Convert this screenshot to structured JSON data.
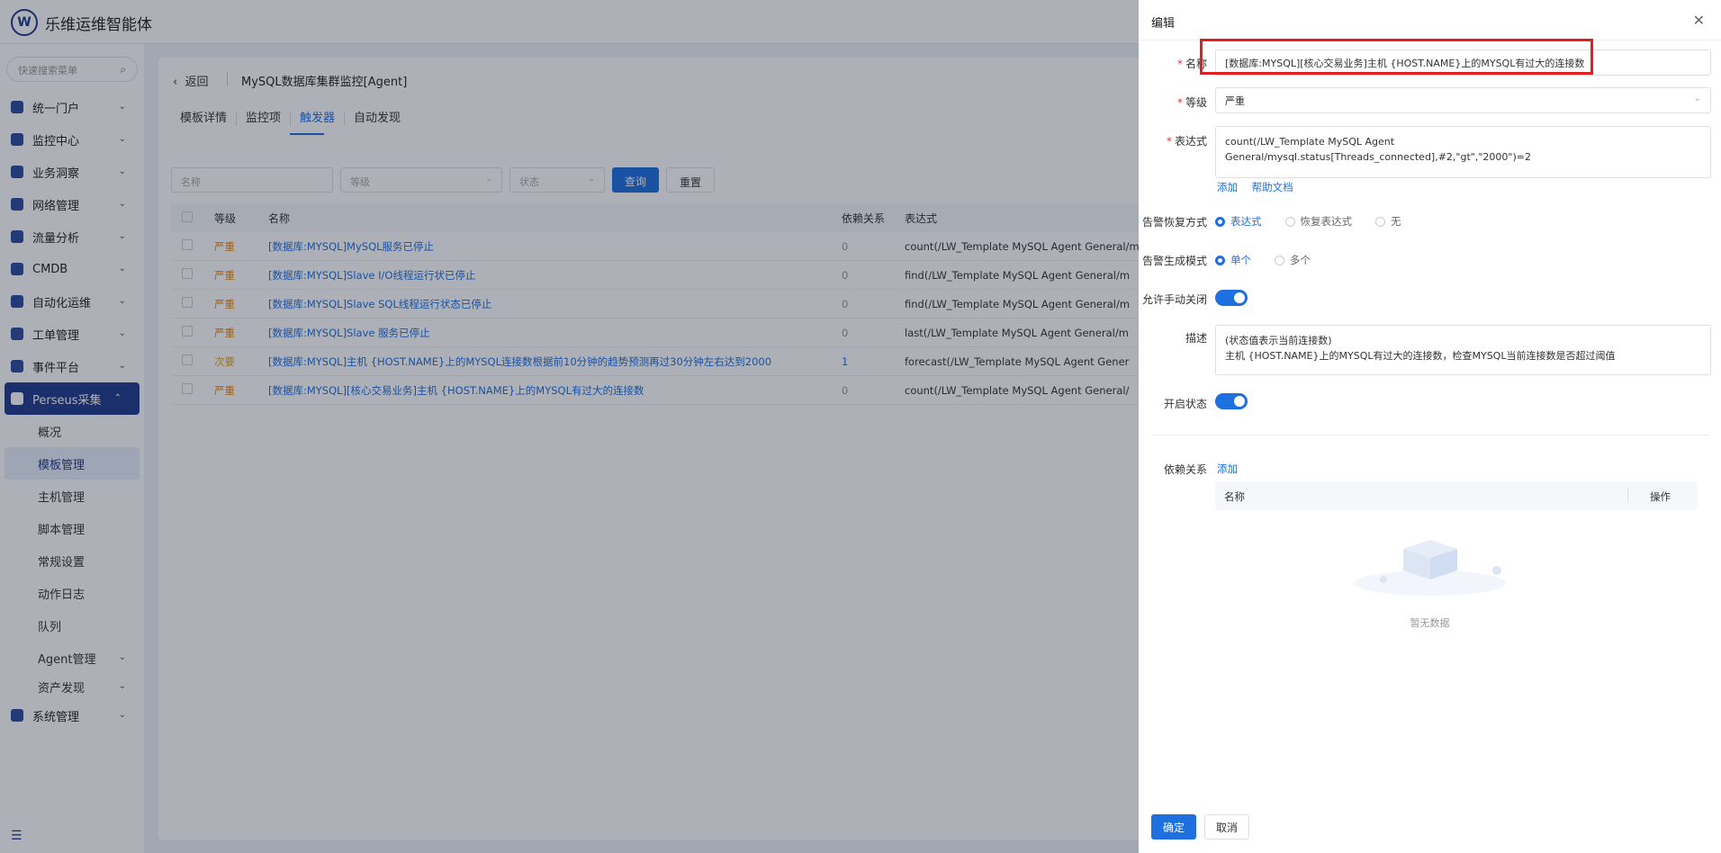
{
  "brand": {
    "logo": "W",
    "name": "乐维运维智能体"
  },
  "sidebar": {
    "search_placeholder": "快速搜索菜单",
    "items": [
      {
        "label": "统一门户",
        "icon": "home-icon"
      },
      {
        "label": "监控中心",
        "icon": "monitor-icon"
      },
      {
        "label": "业务洞察",
        "icon": "insight-icon"
      },
      {
        "label": "网络管理",
        "icon": "globe-icon"
      },
      {
        "label": "流量分析",
        "icon": "chart-icon"
      },
      {
        "label": "CMDB",
        "icon": "cube-icon"
      },
      {
        "label": "自动化运维",
        "icon": "gear-icon"
      },
      {
        "label": "工单管理",
        "icon": "ticket-icon"
      },
      {
        "label": "事件平台",
        "icon": "bell-icon"
      },
      {
        "label": "Perseus采集",
        "icon": "perseus-icon"
      }
    ],
    "sub_items": [
      "概况",
      "模板管理",
      "主机管理",
      "脚本管理",
      "常规设置",
      "动作日志",
      "队列",
      "Agent管理",
      "资产发现"
    ],
    "last_item": {
      "label": "系统管理",
      "icon": "settings-icon"
    }
  },
  "main": {
    "back": "返回",
    "title": "MySQL数据库集群监控[Agent]",
    "tabs": [
      "模板详情",
      "监控项",
      "触发器",
      "自动发现"
    ],
    "filters": {
      "name": "名称",
      "level": "等级",
      "status": "状态",
      "query": "查询",
      "reset": "重置"
    },
    "table": {
      "headers": [
        "等级",
        "名称",
        "依赖关系",
        "表达式"
      ],
      "rows": [
        {
          "level": "严重",
          "name": "[数据库:MYSQL]MySQL服务已停止",
          "deps": "0",
          "expr": "count(/LW_Template MySQL Agent General/m"
        },
        {
          "level": "严重",
          "name": "[数据库:MYSQL]Slave I/O线程运行状已停止",
          "deps": "0",
          "expr": "find(/LW_Template MySQL Agent General/m"
        },
        {
          "level": "严重",
          "name": "[数据库:MYSQL]Slave SQL线程运行状态已停止",
          "deps": "0",
          "expr": "find(/LW_Template MySQL Agent General/m"
        },
        {
          "level": "严重",
          "name": "[数据库:MYSQL]Slave 服务已停止",
          "deps": "0",
          "expr": "last(/LW_Template MySQL Agent General/m"
        },
        {
          "level": "次要",
          "name": "[数据库:MYSQL]主机 {HOST.NAME}上的MYSQL连接数根据前10分钟的趋势预测再过30分钟左右达到2000",
          "deps": "1",
          "expr": "forecast(/LW_Template MySQL Agent Gener"
        },
        {
          "level": "严重",
          "name": "[数据库:MYSQL][核心交易业务]主机 {HOST.NAME}上的MYSQL有过大的连接数",
          "deps": "0",
          "expr": "count(/LW_Template MySQL Agent General/"
        }
      ]
    }
  },
  "drawer": {
    "title": "编辑",
    "name_label": "名称",
    "name_value": "[数据库:MYSQL][核心交易业务]主机 {HOST.NAME}上的MYSQL有过大的连接数",
    "level_label": "等级",
    "level_value": "严重",
    "expr_label": "表达式",
    "expr_value": "count(/LW_Template MySQL Agent General/mysql.status[Threads_connected],#2,\"gt\",\"2000\")=2",
    "add": "添加",
    "help": "帮助文档",
    "recovery_label": "告警恢复方式",
    "recovery_options": [
      "表达式",
      "恢复表达式",
      "无"
    ],
    "gen_label": "告警生成模式",
    "gen_options": [
      "单个",
      "多个"
    ],
    "manual_close_label": "允许手动关闭",
    "desc_label": "描述",
    "desc_line1": "(状态值表示当前连接数)",
    "desc_line2": "主机 {HOST.NAME}上的MYSQL有过大的连接数，检查MYSQL当前连接数是否超过阈值",
    "enabled_label": "开启状态",
    "deps_label": "依赖关系",
    "deps_add": "添加",
    "deps_cols": [
      "名称",
      "操作"
    ],
    "empty": "暂无数据",
    "ok": "确定",
    "cancel": "取消"
  },
  "colors": {
    "primary": "#1e6fe0",
    "nav_active": "#1e3a8a",
    "severe": "#e6840f",
    "highlight": "#e02020"
  }
}
